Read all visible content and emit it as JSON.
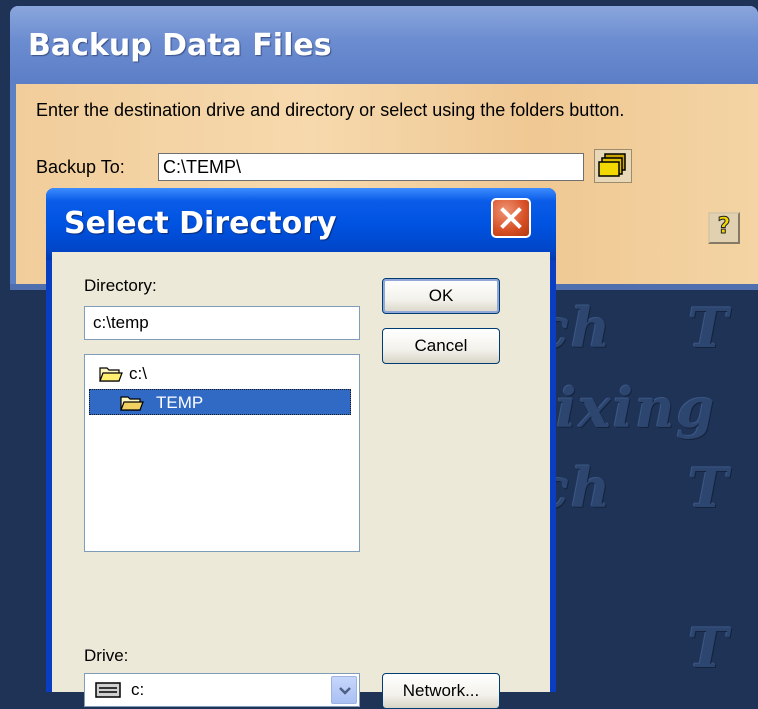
{
  "background_watermark": {
    "words": [
      "ch",
      "T",
      "ixing",
      "T",
      "ch",
      "T"
    ]
  },
  "backup_window": {
    "title": "Backup Data Files",
    "instruction": "Enter the destination drive and directory or select using the folders button.",
    "backup_to_label": "Backup To:",
    "backup_to_value": "C:\\TEMP\\",
    "folders_button_icon": "folders-icon",
    "help_button_label": "?"
  },
  "select_directory_dialog": {
    "title": "Select Directory",
    "close_icon": "close-icon",
    "directory_label": "Directory:",
    "directory_value": "c:\\temp",
    "folders": [
      {
        "name": "c:\\",
        "icon": "open-folder-icon",
        "selected": false
      },
      {
        "name": "TEMP",
        "icon": "open-folder-icon",
        "selected": true
      }
    ],
    "drive_label": "Drive:",
    "drive_value": "c:",
    "buttons": {
      "ok": "OK",
      "cancel": "Cancel",
      "network": "Network..."
    }
  },
  "colors": {
    "desktop_background": "#1f3356",
    "title_bar_blue": "#0053e1",
    "dialog_face": "#ece9d8",
    "selection": "#316ac5",
    "window_panel": "#f1cd9b"
  }
}
